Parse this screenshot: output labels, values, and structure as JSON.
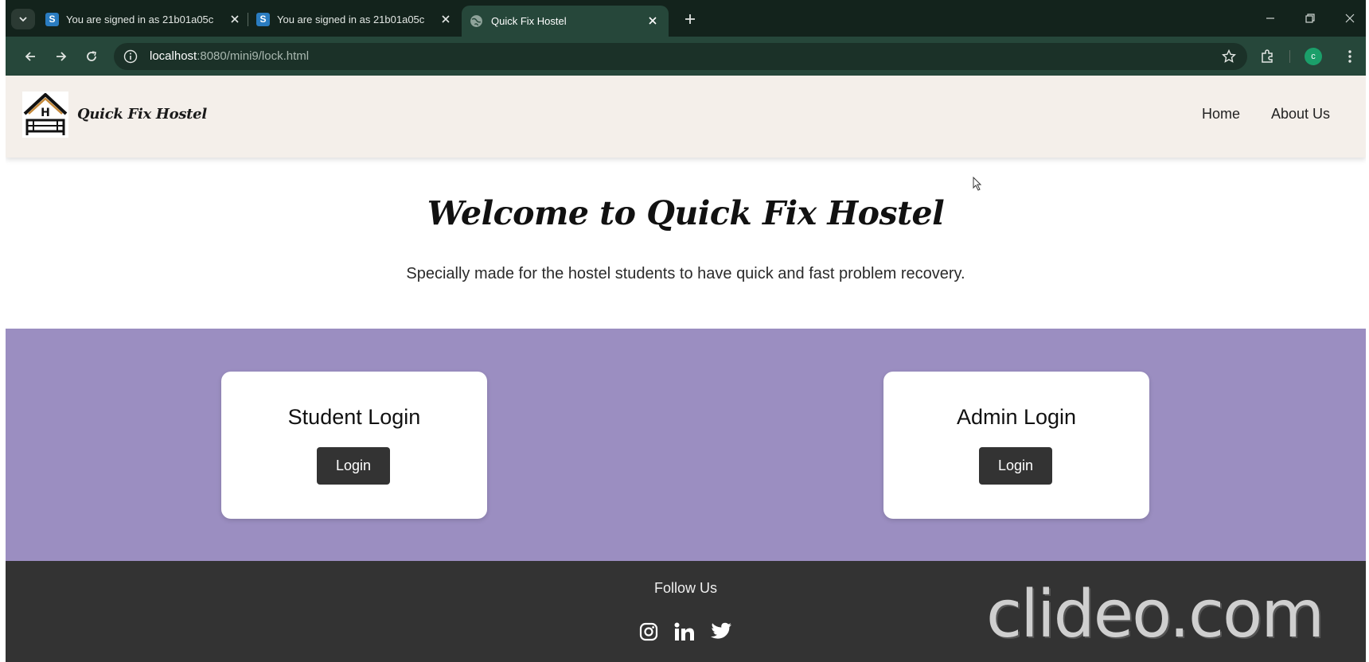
{
  "browser": {
    "tabs": [
      {
        "title": "You are signed in as 21b01a05c",
        "favicon": "S"
      },
      {
        "title": "You are signed in as 21b01a05c",
        "favicon": "S"
      }
    ],
    "active_tab": {
      "title": "Quick Fix Hostel"
    },
    "address": {
      "host": "localhost",
      "path": ":8080/mini9/lock.html"
    },
    "profile_initial": "c"
  },
  "header": {
    "brand": "Quick Fix Hostel",
    "nav": [
      {
        "label": "Home"
      },
      {
        "label": "About Us"
      }
    ]
  },
  "hero": {
    "title": "Welcome to Quick Fix Hostel",
    "subtitle": "Specially made for the hostel students to have quick and fast problem recovery."
  },
  "logins": [
    {
      "title": "Student Login",
      "button": "Login"
    },
    {
      "title": "Admin Login",
      "button": "Login"
    }
  ],
  "footer": {
    "follow": "Follow Us",
    "social": [
      "instagram-icon",
      "linkedin-icon",
      "twitter-icon"
    ],
    "watermark": "clideo.com"
  },
  "colors": {
    "tab_bar": "#13231c",
    "toolbar": "#26473a",
    "header_bg": "#f4efea",
    "band": "#9b8ec1",
    "footer": "#333333",
    "button": "#333333"
  }
}
